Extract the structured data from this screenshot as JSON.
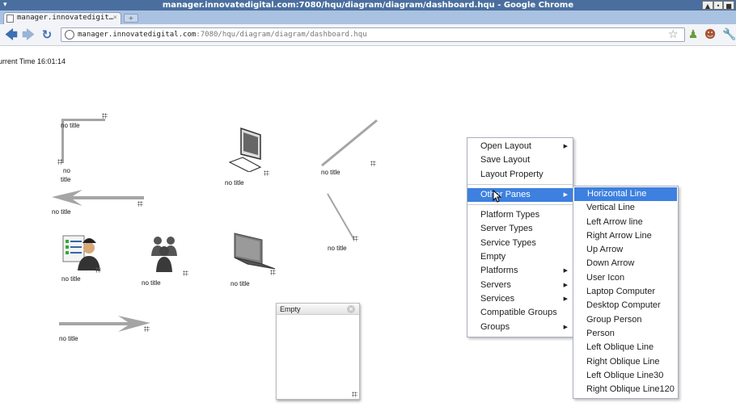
{
  "window": {
    "title": "manager.innovatedigital.com:7080/hqu/diagram/diagram/dashboard.hqu - Google Chrome"
  },
  "tab": {
    "label": "manager.innovatedigit…",
    "close": "×"
  },
  "omnibox": {
    "host": "manager.innovatedigital.com",
    "path": ":7080/hqu/diagram/diagram/dashboard.hqu"
  },
  "page": {
    "current_time": "urrent Time 16:01:14",
    "no_title": "no title",
    "no_title_line1": "no",
    "no_title_line2": "title"
  },
  "empty_panel": {
    "title": "Empty"
  },
  "context_menu": {
    "group1": [
      "Open Layout",
      "Save Layout",
      "Layout Property"
    ],
    "selected": "Other Panes",
    "group2": [
      "Platform Types",
      "Server Types",
      "Service Types",
      "Empty",
      "Platforms",
      "Servers",
      "Services",
      "Compatible Groups",
      "Groups"
    ]
  },
  "submenu": {
    "items": [
      "Horizontal Line",
      "Vertical Line",
      "Left Arrow line",
      "Right Arrow Line",
      "Up Arrow",
      "Down Arrow",
      "User Icon",
      "Laptop Computer",
      "Desktop Computer",
      "Group Person",
      "Person",
      "Left Oblique Line",
      "Right Oblique Line",
      "Left Oblique Line30",
      "Right Oblique Line120"
    ]
  },
  "colors": {
    "menu_highlight": "#3d80df",
    "titlebar": "#4a6f9e",
    "line": "#a5a5a5"
  }
}
